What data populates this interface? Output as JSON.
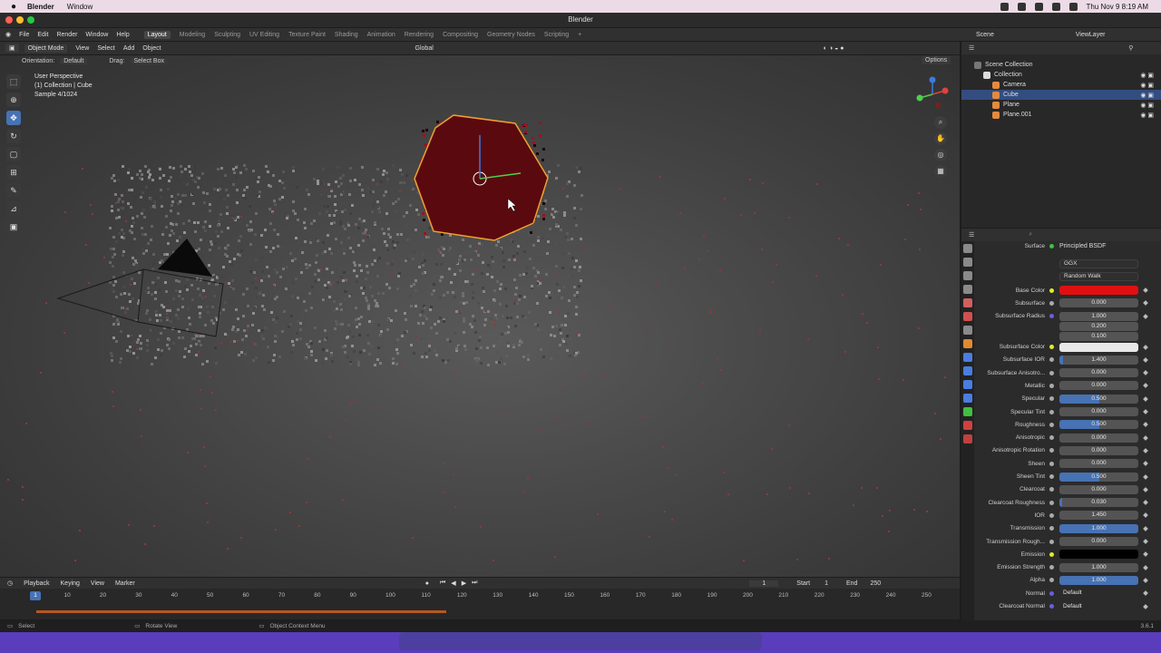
{
  "macos": {
    "app_name": "Blender",
    "menu": [
      "Window"
    ],
    "clock": "Thu Nov 9  8:19 AM"
  },
  "window": {
    "title": "Blender"
  },
  "topbar": {
    "menus": [
      "File",
      "Edit",
      "Render",
      "Window",
      "Help"
    ],
    "workspaces": [
      "Layout",
      "Modeling",
      "Sculpting",
      "UV Editing",
      "Texture Paint",
      "Shading",
      "Animation",
      "Rendering",
      "Compositing",
      "Geometry Nodes",
      "Scripting"
    ],
    "active_workspace": "Layout",
    "scene": "Scene",
    "view_layer": "ViewLayer"
  },
  "viewport": {
    "mode": "Object Mode",
    "menus": [
      "View",
      "Select",
      "Add",
      "Object"
    ],
    "transform": "Global",
    "orientation_label": "Orientation:",
    "orientation_value": "Default",
    "drag_label": "Drag:",
    "drag_value": "Select Box",
    "options": "Options",
    "info_line1": "User Perspective",
    "info_line2": "(1) Collection | Cube",
    "info_line3": "Sample 4/1024"
  },
  "outliner": {
    "root": "Scene Collection",
    "items": [
      {
        "label": "Collection",
        "indent": 1,
        "selected": false,
        "color": "#dddddd"
      },
      {
        "label": "Camera",
        "indent": 2,
        "selected": false,
        "color": "#e58a3c"
      },
      {
        "label": "Cube",
        "indent": 2,
        "selected": true,
        "color": "#e58a3c"
      },
      {
        "label": "Plane",
        "indent": 2,
        "selected": false,
        "color": "#e58a3c"
      },
      {
        "label": "Plane.001",
        "indent": 2,
        "selected": false,
        "color": "#e58a3c"
      }
    ]
  },
  "properties": {
    "surface_label": "Surface",
    "surface_value": "Principled BSDF",
    "distribution": "GGX",
    "subsurface_method": "Random Walk",
    "rows": [
      {
        "label": "Base Color",
        "type": "color",
        "color": "#e01010",
        "dot": "#e8e820"
      },
      {
        "label": "Subsurface",
        "value": "0.000",
        "dot": "#aaaaaa"
      },
      {
        "label": "Subsurface Radius",
        "value": "1.000",
        "dot": "#6a5fd8"
      },
      {
        "label": "",
        "value": "0.200",
        "dot": ""
      },
      {
        "label": "",
        "value": "0.100",
        "dot": ""
      },
      {
        "label": "Subsurface Color",
        "type": "color",
        "color": "#e8e8e8",
        "dot": "#e8e820"
      },
      {
        "label": "Subsurface IOR",
        "value": "1.400",
        "dot": "#aaaaaa",
        "fill": 0.05
      },
      {
        "label": "Subsurface Anisotro...",
        "value": "0.000",
        "dot": "#aaaaaa"
      },
      {
        "label": "Metallic",
        "value": "0.000",
        "dot": "#aaaaaa"
      },
      {
        "label": "Specular",
        "value": "0.500",
        "dot": "#aaaaaa",
        "fill": 0.5
      },
      {
        "label": "Specular Tint",
        "value": "0.000",
        "dot": "#aaaaaa"
      },
      {
        "label": "Roughness",
        "value": "0.500",
        "dot": "#aaaaaa",
        "fill": 0.5
      },
      {
        "label": "Anisotropic",
        "value": "0.000",
        "dot": "#aaaaaa"
      },
      {
        "label": "Anisotropic Rotation",
        "value": "0.000",
        "dot": "#aaaaaa"
      },
      {
        "label": "Sheen",
        "value": "0.000",
        "dot": "#aaaaaa"
      },
      {
        "label": "Sheen Tint",
        "value": "0.500",
        "dot": "#aaaaaa",
        "fill": 0.5
      },
      {
        "label": "Clearcoat",
        "value": "0.000",
        "dot": "#aaaaaa"
      },
      {
        "label": "Clearcoat Roughness",
        "value": "0.030",
        "dot": "#aaaaaa",
        "fill": 0.03
      },
      {
        "label": "IOR",
        "value": "1.450",
        "dot": "#aaaaaa"
      },
      {
        "label": "Transmission",
        "value": "1.000",
        "dot": "#aaaaaa",
        "fill": 1.0
      },
      {
        "label": "Transmission Rough...",
        "value": "0.000",
        "dot": "#aaaaaa"
      },
      {
        "label": "Emission",
        "type": "color",
        "color": "#000000",
        "dot": "#e8e820"
      },
      {
        "label": "Emission Strength",
        "value": "1.000",
        "dot": "#aaaaaa"
      },
      {
        "label": "Alpha",
        "value": "1.000",
        "dot": "#aaaaaa",
        "fill": 1.0
      },
      {
        "label": "Normal",
        "value": "Default",
        "dot": "#6a5fd8",
        "type": "text"
      },
      {
        "label": "Clearcoat Normal",
        "value": "Default",
        "dot": "#6a5fd8",
        "type": "text"
      }
    ]
  },
  "timeline": {
    "menus": [
      "Playback",
      "Keying",
      "View",
      "Marker"
    ],
    "current_frame": "1",
    "start_label": "Start",
    "start": "1",
    "end_label": "End",
    "end": "250",
    "ticks": [
      "1",
      "10",
      "20",
      "30",
      "40",
      "50",
      "60",
      "70",
      "80",
      "90",
      "100",
      "110",
      "120",
      "130",
      "140",
      "150",
      "160",
      "170",
      "180",
      "190",
      "200",
      "210",
      "220",
      "230",
      "240",
      "250"
    ]
  },
  "status": {
    "select": "Select",
    "rotate": "Rotate View",
    "context": "Object Context Menu",
    "version": "3.6.1"
  }
}
